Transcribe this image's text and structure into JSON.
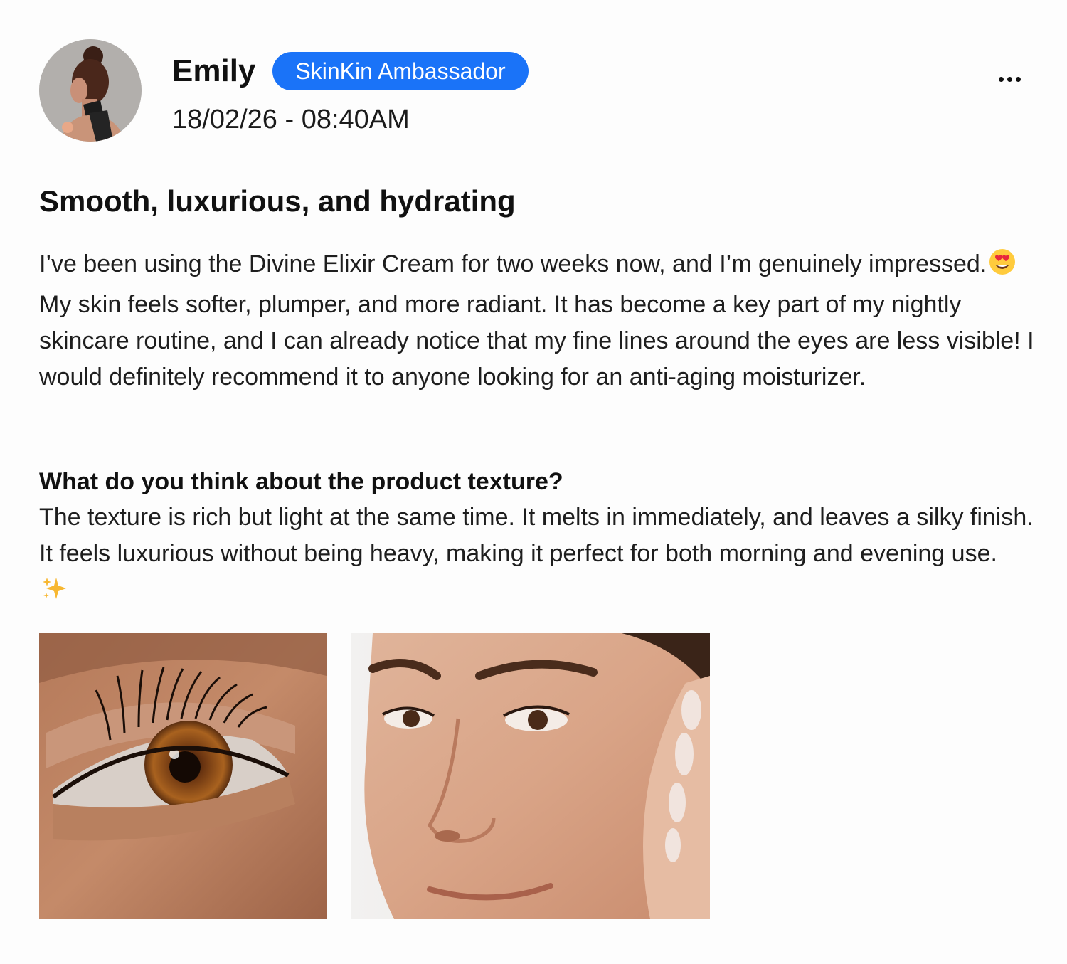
{
  "author": {
    "name": "Emily",
    "badge": "SkinKin Ambassador",
    "timestamp": "18/02/26 - 08:40AM",
    "avatar_icon": "avatar-photo"
  },
  "menu": {
    "icon": "more-horizontal-icon"
  },
  "review": {
    "title": "Smooth, luxurious, and hydrating",
    "body_part1": "I’ve been using the Divine Elixir Cream for two weeks now, and I’m genuinely impressed.",
    "body_emoji_icon": "heart-eyes-emoji-icon",
    "body_part2": "My skin feels softer, plumper, and more radiant. It has become a key part of my nightly skincare routine, and I can already notice that my fine lines around the eyes are less visible! I would definitely recommend it to anyone looking for an anti-aging moisturizer."
  },
  "qa": {
    "question": "What do you think about the product texture?",
    "answer": "The texture is rich but light at the same time. It melts in immediately, and leaves a silky finish. It feels luxurious without being heavy, making it perfect for both morning and evening use.",
    "answer_emoji_icon": "sparkles-emoji-icon"
  },
  "photos": [
    {
      "name": "eye-closeup-photo"
    },
    {
      "name": "face-applying-cream-photo"
    }
  ],
  "colors": {
    "badge_bg": "#1a73f8",
    "badge_text": "#ffffff",
    "text_primary": "#111111",
    "background": "#fdfdfd"
  }
}
